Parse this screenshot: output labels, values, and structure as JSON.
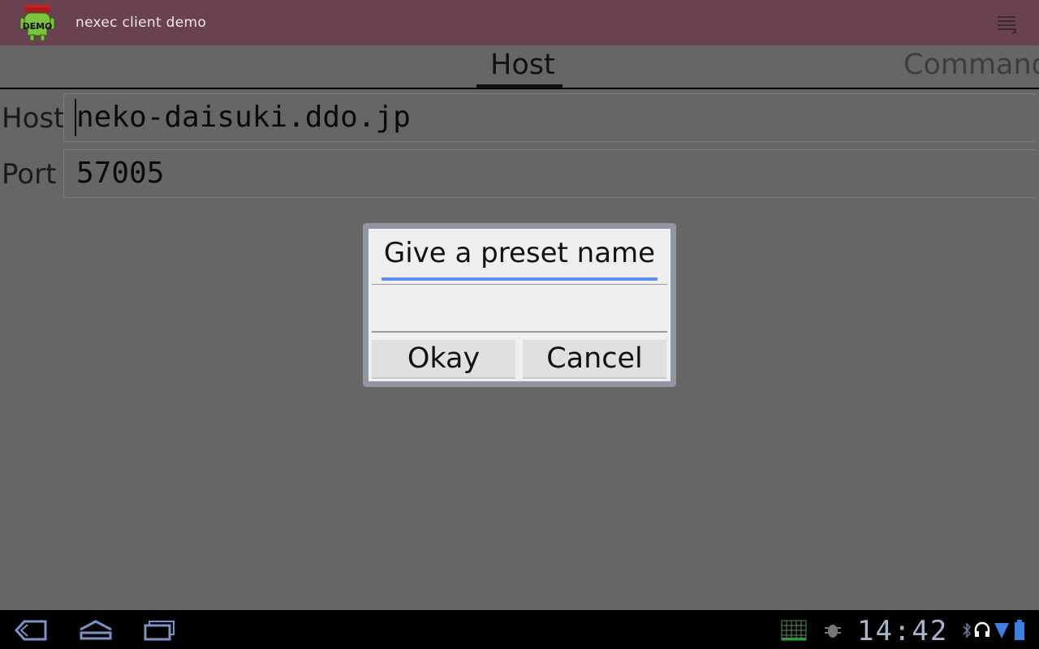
{
  "app": {
    "title": "nexec client demo",
    "icon": "demo-android-icon",
    "icon_text": "DEMO"
  },
  "tabs": [
    {
      "label": "Host",
      "selected": true
    },
    {
      "label": "Command",
      "selected": false
    }
  ],
  "form": {
    "host_label": "Host",
    "host_value": "neko-daisuki.ddo.jp",
    "port_label": "Port",
    "port_value": "57005"
  },
  "dialog": {
    "title": "Give a preset name",
    "input_value": "",
    "okay_label": "Okay",
    "cancel_label": "Cancel"
  },
  "status_bar": {
    "clock": "14:42",
    "icons": [
      "grid-icon",
      "bug-icon",
      "bluetooth-icon",
      "headset-icon",
      "wifi-icon",
      "battery-icon"
    ]
  },
  "nav_bar": {
    "icons": [
      "back-icon",
      "home-icon",
      "recent-apps-icon"
    ]
  },
  "colors": {
    "action_bar": "#6a4150",
    "background": "#666666",
    "dialog_accent": "#5b8ff0",
    "dialog_frame": "#8f97a2"
  }
}
